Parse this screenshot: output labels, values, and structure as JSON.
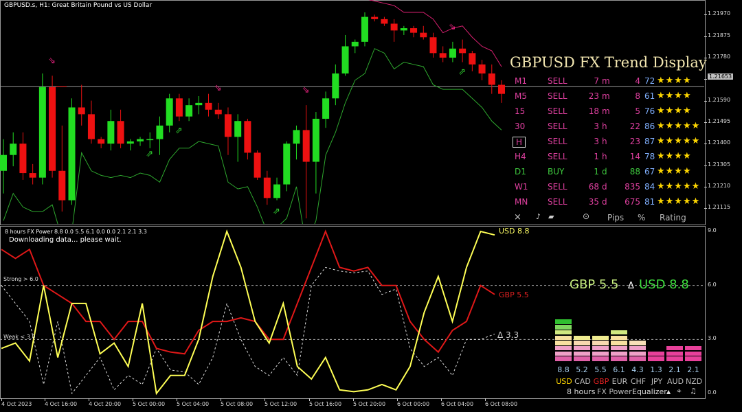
{
  "chart_header": "GBPUSD.s, H1:  Great Britain Pound vs US Dollar",
  "price_axis": {
    "ticks": [
      "1.21970",
      "1.21875",
      "1.21780",
      "1.21685",
      "1.21590",
      "1.21495",
      "1.21400",
      "1.21305",
      "1.21210",
      "1.21115"
    ],
    "current_price": "1.21653"
  },
  "trend_display": {
    "title": "GBPUSD FX Trend Display",
    "rows": [
      {
        "tf": "M1",
        "signal": "SELL",
        "dur": "7",
        "unit": "m",
        "pips": "4",
        "pct": "72",
        "stars": "★★★★",
        "tf_color": "#e040a0",
        "sig_color": "#e040a0",
        "boxed": false
      },
      {
        "tf": "M5",
        "signal": "SELL",
        "dur": "23",
        "unit": "m",
        "pips": "8",
        "pct": "61",
        "stars": "★★★★",
        "tf_color": "#e040a0",
        "sig_color": "#e040a0",
        "boxed": false
      },
      {
        "tf": "15",
        "signal": "SELL",
        "dur": "18",
        "unit": "m",
        "pips": "5",
        "pct": "76",
        "stars": "★★★★",
        "tf_color": "#e040a0",
        "sig_color": "#e040a0",
        "boxed": false
      },
      {
        "tf": "30",
        "signal": "SELL",
        "dur": "3",
        "unit": "h",
        "pips": "22",
        "pct": "86",
        "stars": "★★★★★",
        "tf_color": "#e040a0",
        "sig_color": "#e040a0",
        "boxed": false
      },
      {
        "tf": "H",
        "signal": "SELL",
        "dur": "3",
        "unit": "h",
        "pips": "23",
        "pct": "87",
        "stars": "★★★★★",
        "tf_color": "#e040a0",
        "sig_color": "#e040a0",
        "boxed": true
      },
      {
        "tf": "H4",
        "signal": "SELL",
        "dur": "1",
        "unit": "h",
        "pips": "14",
        "pct": "78",
        "stars": "★★★★",
        "tf_color": "#e040a0",
        "sig_color": "#e040a0",
        "boxed": false
      },
      {
        "tf": "D1",
        "signal": "BUY",
        "dur": "1",
        "unit": "d",
        "pips": "88",
        "pct": "67",
        "stars": "★★★★",
        "tf_color": "#3ec83e",
        "sig_color": "#3ec83e",
        "boxed": false
      },
      {
        "tf": "W1",
        "signal": "SELL",
        "dur": "68",
        "unit": "d",
        "pips": "835",
        "pct": "84",
        "stars": "★★★★★",
        "tf_color": "#e040a0",
        "sig_color": "#e040a0",
        "boxed": false
      },
      {
        "tf": "MN",
        "signal": "SELL",
        "dur": "35",
        "unit": "d",
        "pips": "675",
        "pct": "81",
        "stars": "★★★★★",
        "tf_color": "#e040a0",
        "sig_color": "#e040a0",
        "boxed": false
      }
    ],
    "footer": {
      "close": "×",
      "pips": "Pips",
      "pct": "%",
      "rating": "Rating"
    }
  },
  "power_pane": {
    "header": "8 hours FX Power 8.8 0.0 5.5 6.1 0.0 0.0 2.1 2.1 3.3",
    "status": "Downloading data... please wait.",
    "strong_label": "Strong > 6.0",
    "weak_label": "Weak < 3.0",
    "right_ticks": [
      "9.0",
      "6.0",
      "3.0",
      "0.0"
    ],
    "usd_label": "USD 8.8",
    "gbp_label": "GBP 5.5",
    "delta_label": "Δ 3.3",
    "summary": {
      "left": "GBP 5.5",
      "mid": "Δ",
      "right": "USD 8.8"
    },
    "time_labels": [
      "4 Oct 2023",
      "4 Oct 16:00",
      "4 Oct 20:00",
      "5 Oct 00:00",
      "5 Oct 04:00",
      "5 Oct 08:00",
      "5 Oct 12:00",
      "5 Oct 16:00",
      "5 Oct 20:00",
      "6 Oct 00:00",
      "6 Oct 04:00",
      "6 Oct 08:00"
    ]
  },
  "equalizer": {
    "currencies": [
      {
        "code": "USD",
        "value": "8.8",
        "bars": 8,
        "palette": "green",
        "code_color": "#ffd700"
      },
      {
        "code": "CAD",
        "value": "5.2",
        "bars": 5,
        "palette": "yellow",
        "code_color": "#bbbbbb"
      },
      {
        "code": "GBP",
        "value": "5.5",
        "bars": 5,
        "palette": "yellow",
        "code_color": "#e02020"
      },
      {
        "code": "EUR",
        "value": "6.1",
        "bars": 6,
        "palette": "green",
        "code_color": "#bbbbbb"
      },
      {
        "code": "CHF",
        "value": "4.3",
        "bars": 4,
        "palette": "pink",
        "code_color": "#bbbbbb"
      },
      {
        "code": "JPY",
        "value": "1.3",
        "bars": 2,
        "palette": "magenta",
        "code_color": "#bbbbbb"
      },
      {
        "code": "AUD",
        "value": "2.1",
        "bars": 3,
        "palette": "magenta",
        "code_color": "#bbbbbb"
      },
      {
        "code": "NZD",
        "value": "2.1",
        "bars": 3,
        "palette": "magenta",
        "code_color": "#bbbbbb"
      }
    ],
    "footer": {
      "period": "8 hours",
      "title": "FX Power",
      "mode": "Equalizer"
    }
  },
  "chart_data": [
    {
      "type": "candlestick",
      "title": "GBPUSD.s, H1:  Great Britain Pound vs US Dollar",
      "ylim": [
        1.2107,
        1.2198
      ],
      "ohlc": [
        [
          1.2128,
          1.2142,
          1.2118,
          1.2135
        ],
        [
          1.2135,
          1.2145,
          1.213,
          1.214
        ],
        [
          1.214,
          1.2145,
          1.2124,
          1.2127
        ],
        [
          1.2127,
          1.2131,
          1.2122,
          1.2125
        ],
        [
          1.2125,
          1.2171,
          1.2122,
          1.2165
        ],
        [
          1.2165,
          1.217,
          1.2125,
          1.2128
        ],
        [
          1.2128,
          1.2148,
          1.211,
          1.2115
        ],
        [
          1.2115,
          1.216,
          1.2113,
          1.2156
        ],
        [
          1.2156,
          1.2166,
          1.2148,
          1.2153
        ],
        [
          1.2153,
          1.2159,
          1.214,
          1.2142
        ],
        [
          1.2142,
          1.2143,
          1.2138,
          1.214
        ],
        [
          1.214,
          1.2155,
          1.2137,
          1.215
        ],
        [
          1.215,
          1.2155,
          1.2138,
          1.214
        ],
        [
          1.214,
          1.2142,
          1.2137,
          1.2141
        ],
        [
          1.2141,
          1.2143,
          1.2139,
          1.2142
        ],
        [
          1.2142,
          1.2145,
          1.2138,
          1.2142
        ],
        [
          1.2142,
          1.2152,
          1.2135,
          1.2148
        ],
        [
          1.2148,
          1.2162,
          1.2145,
          1.216
        ],
        [
          1.216,
          1.2162,
          1.215,
          1.2152
        ],
        [
          1.2152,
          1.216,
          1.215,
          1.2157
        ],
        [
          1.2157,
          1.2161,
          1.2153,
          1.2158
        ],
        [
          1.2158,
          1.2162,
          1.2152,
          1.2155
        ],
        [
          1.2155,
          1.2158,
          1.2151,
          1.2153
        ],
        [
          1.2153,
          1.2156,
          1.2135,
          1.2143
        ],
        [
          1.2143,
          1.2153,
          1.2132,
          1.215
        ],
        [
          1.215,
          1.2151,
          1.2133,
          1.2136
        ],
        [
          1.2136,
          1.2137,
          1.2124,
          1.2125
        ],
        [
          1.2125,
          1.2128,
          1.2113,
          1.2116
        ],
        [
          1.2116,
          1.2125,
          1.2115,
          1.2122
        ],
        [
          1.2122,
          1.2141,
          1.2119,
          1.214
        ],
        [
          1.214,
          1.2148,
          1.2133,
          1.2146
        ],
        [
          1.2146,
          1.2157,
          1.2107,
          1.2132
        ],
        [
          1.2132,
          1.2154,
          1.2118,
          1.2151
        ],
        [
          1.2151,
          1.2163,
          1.2147,
          1.216
        ],
        [
          1.216,
          1.2175,
          1.2157,
          1.2171
        ],
        [
          1.2171,
          1.2188,
          1.217,
          1.2183
        ],
        [
          1.2183,
          1.2186,
          1.218,
          1.2185
        ],
        [
          1.2185,
          1.2198,
          1.2183,
          1.2196
        ],
        [
          1.2196,
          1.2197,
          1.2194,
          1.2195
        ],
        [
          1.2195,
          1.2196,
          1.2192,
          1.2193
        ],
        [
          1.2193,
          1.2195,
          1.2185,
          1.219
        ],
        [
          1.219,
          1.2192,
          1.2188,
          1.2191
        ],
        [
          1.2191,
          1.2192,
          1.2187,
          1.2189
        ],
        [
          1.2189,
          1.2192,
          1.2186,
          1.2187
        ],
        [
          1.2187,
          1.2189,
          1.2178,
          1.218
        ],
        [
          1.218,
          1.2183,
          1.2176,
          1.2178
        ],
        [
          1.2178,
          1.2185,
          1.2176,
          1.2182
        ],
        [
          1.2182,
          1.2186,
          1.2176,
          1.218
        ],
        [
          1.218,
          1.2181,
          1.2172,
          1.2175
        ],
        [
          1.2175,
          1.2177,
          1.2168,
          1.2171
        ],
        [
          1.2171,
          1.2175,
          1.2162,
          1.2166
        ],
        [
          1.2166,
          1.2168,
          1.2158,
          1.2162
        ]
      ],
      "price_ticks": [
        1.2197,
        1.21875,
        1.2178,
        1.21685,
        1.2159,
        1.21495,
        1.214,
        1.21305,
        1.2121,
        1.21115
      ],
      "current_price": 1.21653
    },
    {
      "type": "line",
      "title": "8 hours FX Power 8.8 0.0 5.5 6.1 0.0 0.0 2.1 2.1 3.3",
      "ylim": [
        0,
        9
      ],
      "right_ticks": [
        9.0,
        6.0,
        3.0,
        0.0
      ],
      "strong_level": 6.0,
      "weak_level": 3.0,
      "series": [
        {
          "name": "USD",
          "values": [
            2.5,
            2.8,
            1.8,
            6.0,
            2.0,
            5.0,
            5.0,
            2.2,
            2.8,
            1.5,
            5.0,
            0.0,
            1.0,
            1.0,
            3.0,
            6.5,
            9.0,
            7.0,
            4.0,
            2.8,
            5.0,
            1.5,
            0.8,
            2.0,
            0.2,
            0.1,
            0.2,
            0.5,
            0.2,
            1.5,
            4.5,
            6.5,
            4.0,
            7.0,
            9.0,
            8.8
          ]
        },
        {
          "name": "GBP",
          "values": [
            8.0,
            7.5,
            8.0,
            6.0,
            5.5,
            5.0,
            4.0,
            4.0,
            3.0,
            4.0,
            4.0,
            2.5,
            2.3,
            2.2,
            3.5,
            4.0,
            4.0,
            4.2,
            4.0,
            3.0,
            3.0,
            5.0,
            7.0,
            9.0,
            7.0,
            6.8,
            7.0,
            6.0,
            6.0,
            4.0,
            3.0,
            2.3,
            3.5,
            4.0,
            6.0,
            5.5
          ]
        },
        {
          "name": "Δ",
          "values": [
            6.0,
            5.0,
            4.0,
            0.5,
            4.0,
            0.0,
            1.0,
            2.0,
            0.2,
            1.0,
            0.5,
            2.5,
            1.3,
            1.2,
            0.5,
            2.0,
            5.0,
            3.0,
            1.5,
            1.0,
            2.0,
            1.0,
            6.0,
            7.0,
            6.8,
            6.7,
            6.8,
            5.5,
            5.8,
            2.5,
            1.5,
            2.0,
            1.0,
            3.0,
            3.0,
            3.3
          ]
        }
      ],
      "x_labels": [
        "4 Oct 2023",
        "4 Oct 16:00",
        "4 Oct 20:00",
        "5 Oct 00:00",
        "5 Oct 04:00",
        "5 Oct 08:00",
        "5 Oct 12:00",
        "5 Oct 16:00",
        "5 Oct 20:00",
        "6 Oct 00:00",
        "6 Oct 04:00",
        "6 Oct 08:00"
      ]
    }
  ]
}
